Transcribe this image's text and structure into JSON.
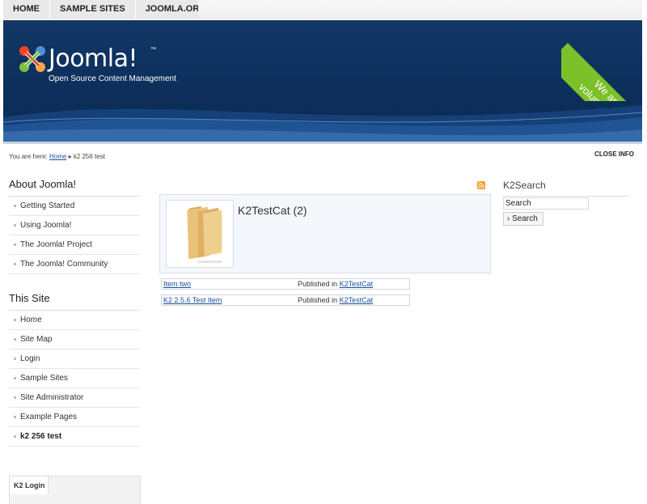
{
  "topnav": {
    "items": [
      "HOME",
      "SAMPLE SITES",
      "JOOMLA.ORG"
    ]
  },
  "header": {
    "logo_text": "Joomla!",
    "logo_tm": "™",
    "tagline": "Open Source Content Management",
    "ribbon_line1": "We are",
    "ribbon_line2": "volunteers!"
  },
  "breadcrumb": {
    "prefix": "You are here:",
    "home": "Home",
    "separator": "▸",
    "current": "k2 256 test"
  },
  "close_info": "CLOSE INFO",
  "left": {
    "about_title": "About Joomla!",
    "about_items": [
      "Getting Started",
      "Using Joomla!",
      "The Joomla! Project",
      "The Joomla! Community"
    ],
    "site_title": "This Site",
    "site_items": [
      "Home",
      "Site Map",
      "Login",
      "Sample Sites",
      "Site Administrator",
      "Example Pages",
      "k2 256 test"
    ],
    "k2login_tab": "K2 Login"
  },
  "category": {
    "title": "K2TestCat (2)",
    "items": [
      {
        "title": "Item two",
        "published_prefix": "Published in",
        "category": "K2TestCat"
      },
      {
        "title": "K2 2.5.6 Test Item",
        "published_prefix": "Published in",
        "category": "K2TestCat"
      }
    ]
  },
  "right": {
    "title": "K2Search",
    "search_value": "Search",
    "search_button": "Search"
  },
  "colors": {
    "header_bg": "#0d2f5c",
    "ribbon": "#7cc02a",
    "link": "#1a4f99",
    "feed": "#f39c30"
  }
}
